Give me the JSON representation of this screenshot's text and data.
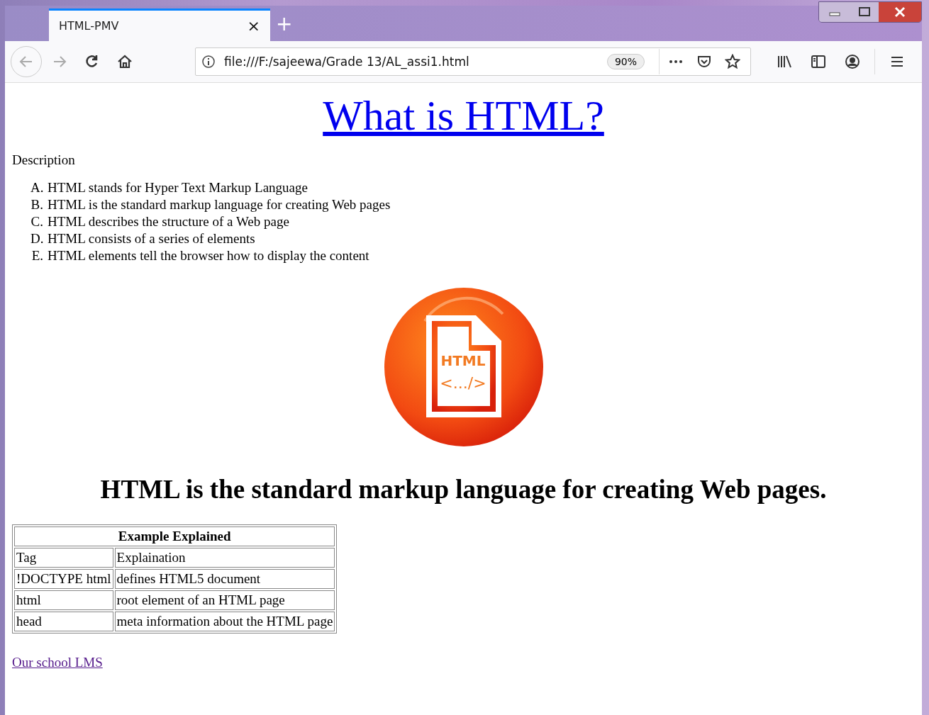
{
  "tabs": [
    {
      "title": "HTML-PMV",
      "selected": true,
      "close": "×"
    }
  ],
  "new_tab": "+",
  "address_bar": {
    "url": "file:///F:/sajeewa/Grade 13/AL_assi1.html",
    "zoom": "90%"
  },
  "page": {
    "title": "What is HTML?",
    "description": "Description",
    "list": [
      {
        "marker": "A.",
        "text": "HTML stands for Hyper Text Markup Language"
      },
      {
        "marker": "B.",
        "text": "HTML is the standard markup language for creating Web pages"
      },
      {
        "marker": "C.",
        "text": "HTML describes the structure of a Web page"
      },
      {
        "marker": "D.",
        "text": "HTML consists of a series of elements"
      },
      {
        "marker": "E.",
        "text": "HTML elements tell the browser how to display the content"
      }
    ],
    "logo": {
      "label": "HTML",
      "code": "<.../>"
    },
    "heading": "HTML is the standard markup language for creating Web pages.",
    "table": {
      "caption": "Example Explained",
      "rows": [
        [
          "Tag",
          "Explaination"
        ],
        [
          "!DOCTYPE html",
          "defines HTML5 document"
        ],
        [
          "html",
          "root element of an HTML page"
        ],
        [
          "head",
          "meta information about the HTML page"
        ]
      ]
    },
    "link": {
      "text": "Our school LMS",
      "visited": true
    }
  }
}
